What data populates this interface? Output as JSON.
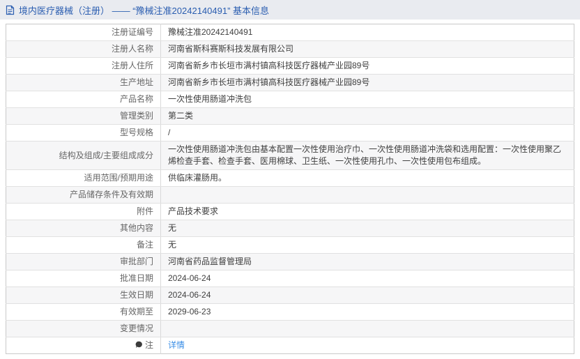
{
  "header": {
    "title": "境内医疗器械（注册） —— “豫械注准20242140491” 基本信息",
    "text_color": "#2a5db0",
    "background": "#e9ebf0",
    "icon": "document-icon"
  },
  "table": {
    "link_color": "#3a8ee6",
    "zebra_color": "#f6f6f7",
    "rows": [
      {
        "label": "注册证编号",
        "value": "豫械注准20242140491"
      },
      {
        "label": "注册人名称",
        "value": "河南省斯科赛斯科技发展有限公司"
      },
      {
        "label": "注册人住所",
        "value": "河南省新乡市长垣市满村镇高科技医疗器械产业园89号"
      },
      {
        "label": "生产地址",
        "value": "河南省新乡市长垣市满村镇高科技医疗器械产业园89号"
      },
      {
        "label": "产品名称",
        "value": "一次性使用肠道冲洗包"
      },
      {
        "label": "管理类别",
        "value": "第二类"
      },
      {
        "label": "型号规格",
        "value": "/"
      },
      {
        "label": "结构及组成/主要组成成分",
        "value": "一次性使用肠道冲洗包由基本配置一次性使用治疗巾、一次性使用肠道冲洗袋和选用配置：一次性使用聚乙烯检查手套、检查手套、医用棉球、卫生纸、一次性使用孔巾、一次性使用包布组成。"
      },
      {
        "label": "适用范围/预期用途",
        "value": "供临床灌肠用。"
      },
      {
        "label": "产品储存条件及有效期",
        "value": ""
      },
      {
        "label": "附件",
        "value": "产品技术要求"
      },
      {
        "label": "其他内容",
        "value": "无"
      },
      {
        "label": "备注",
        "value": "无"
      },
      {
        "label": "审批部门",
        "value": "河南省药品监督管理局"
      },
      {
        "label": "批准日期",
        "value": "2024-06-24"
      },
      {
        "label": "生效日期",
        "value": "2024-06-24"
      },
      {
        "label": "有效期至",
        "value": "2029-06-23"
      },
      {
        "label": "变更情况",
        "value": ""
      },
      {
        "label": "注",
        "value": "详情",
        "link": true,
        "label_icon": "note-icon"
      }
    ]
  }
}
